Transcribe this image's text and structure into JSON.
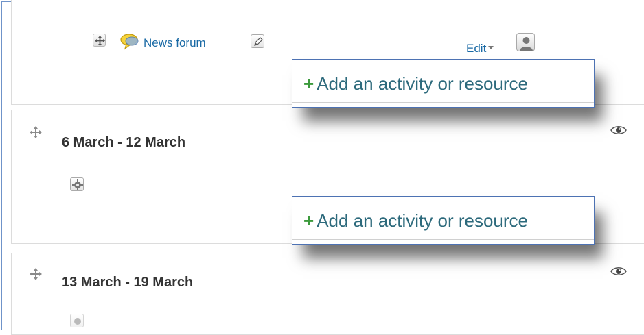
{
  "news_forum": {
    "title": "News forum",
    "edit_menu_label": "Edit"
  },
  "add_activity_label": "Add an activity or resource",
  "sections": [
    {
      "title": "6 March - 12 March"
    },
    {
      "title": "13 March - 19 March"
    }
  ],
  "colors": {
    "link": "#1a6aa5",
    "popup_border": "#4d72b3",
    "plus_icon": "#3c9a3c",
    "frame_border": "#6f93c9"
  },
  "icons": [
    "move-icon",
    "forum-icon",
    "edit-title-icon",
    "role-icon",
    "eye-icon",
    "settings-gear-icon",
    "plus-icon"
  ]
}
